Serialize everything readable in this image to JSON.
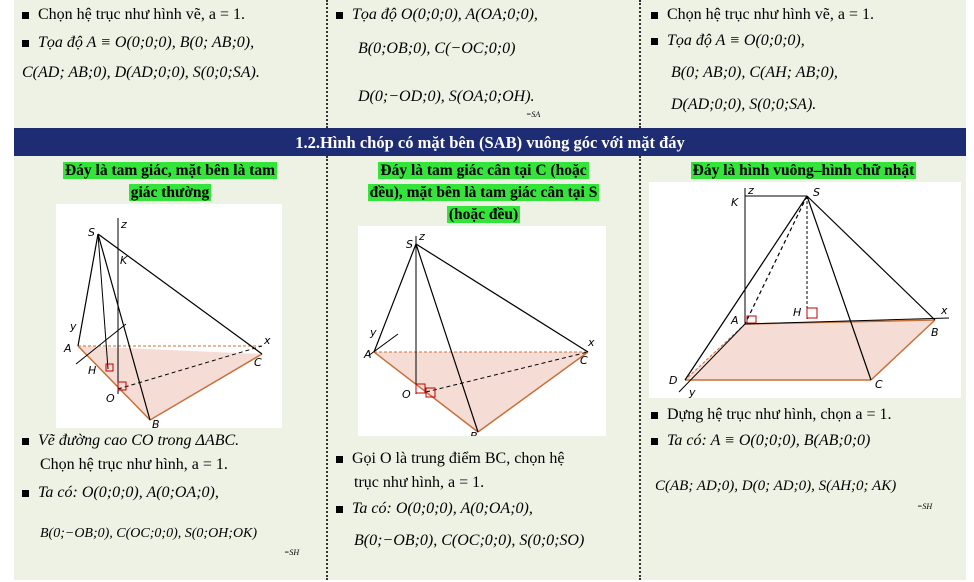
{
  "top": {
    "col1": {
      "l1": "Chọn hệ trục như hình vẽ, a = 1.",
      "l2": "Tọa độ A ≡ O(0;0;0), B(0; AB;0),",
      "l3": "C(AD; AB;0), D(AD;0;0), S(0;0;SA)."
    },
    "col2": {
      "l1": "Tọa độ O(0;0;0), A(OA;0;0),",
      "l2": "B(0;OB;0), C(−OC;0;0)",
      "l3": "D(0;−OD;0), S(OA;0;OH).",
      "l3_sub": "=SA"
    },
    "col3": {
      "l1": "Chọn hệ trục như hình vẽ, a = 1.",
      "l2": "Tọa độ A ≡ O(0;0;0),",
      "l3": "B(0; AB;0), C(AH; AB;0),",
      "l4": "D(AD;0;0), S(0;0;SA)."
    }
  },
  "section_title": "1.2.Hình chóp có mặt bên (SAB) vuông góc với mặt đáy",
  "bottom": {
    "col1": {
      "header_l1": "Đáy là tam giác, mặt bên là tam",
      "header_l2": "giác thường",
      "b1_l1": "Vẽ đường cao CO trong ΔABC.",
      "b1_l2": "Chọn hệ trục như hình, a = 1.",
      "b2_l1": "Ta có: O(0;0;0), A(0;OA;0),",
      "b2_l2": "B(0;−OB;0), C(OC;0;0), S(0;OH;OK)",
      "b2_sub": "=SH",
      "fig_labels": [
        "S",
        "z",
        "K",
        "y",
        "A",
        "H",
        "O",
        "B",
        "C",
        "x"
      ]
    },
    "col2": {
      "header_l1": "Đáy là tam giác cân tại C (hoặc",
      "header_l2": "đều), mặt bên là tam giác cân tại S",
      "header_l3": "(hoặc đều)",
      "b1_l1": "Gọi O là trung điểm BC, chọn hệ",
      "b1_l2": "trục như hình, a = 1.",
      "b2_l1": "Ta có: O(0;0;0), A(0;OA;0),",
      "b2_l2": "B(0;−OB;0), C(OC;0;0), S(0;0;SO)",
      "fig_labels": [
        "S",
        "z",
        "y",
        "A",
        "O",
        "B",
        "C",
        "x"
      ]
    },
    "col3": {
      "header_l1": "Đáy là hình vuông–hình chữ nhật",
      "b1_l1": "Dựng hệ trục như hình, chọn a = 1.",
      "b2_l1": "Ta có: A ≡ O(0;0;0), B(AB;0;0)",
      "b2_l2": "C(AB; AD;0), D(0; AD;0), S(AH;0; AK)",
      "b2_sub": "=SH",
      "fig_labels": [
        "K",
        "z",
        "S",
        "H",
        "A",
        "x",
        "B",
        "D",
        "y",
        "C"
      ]
    }
  }
}
